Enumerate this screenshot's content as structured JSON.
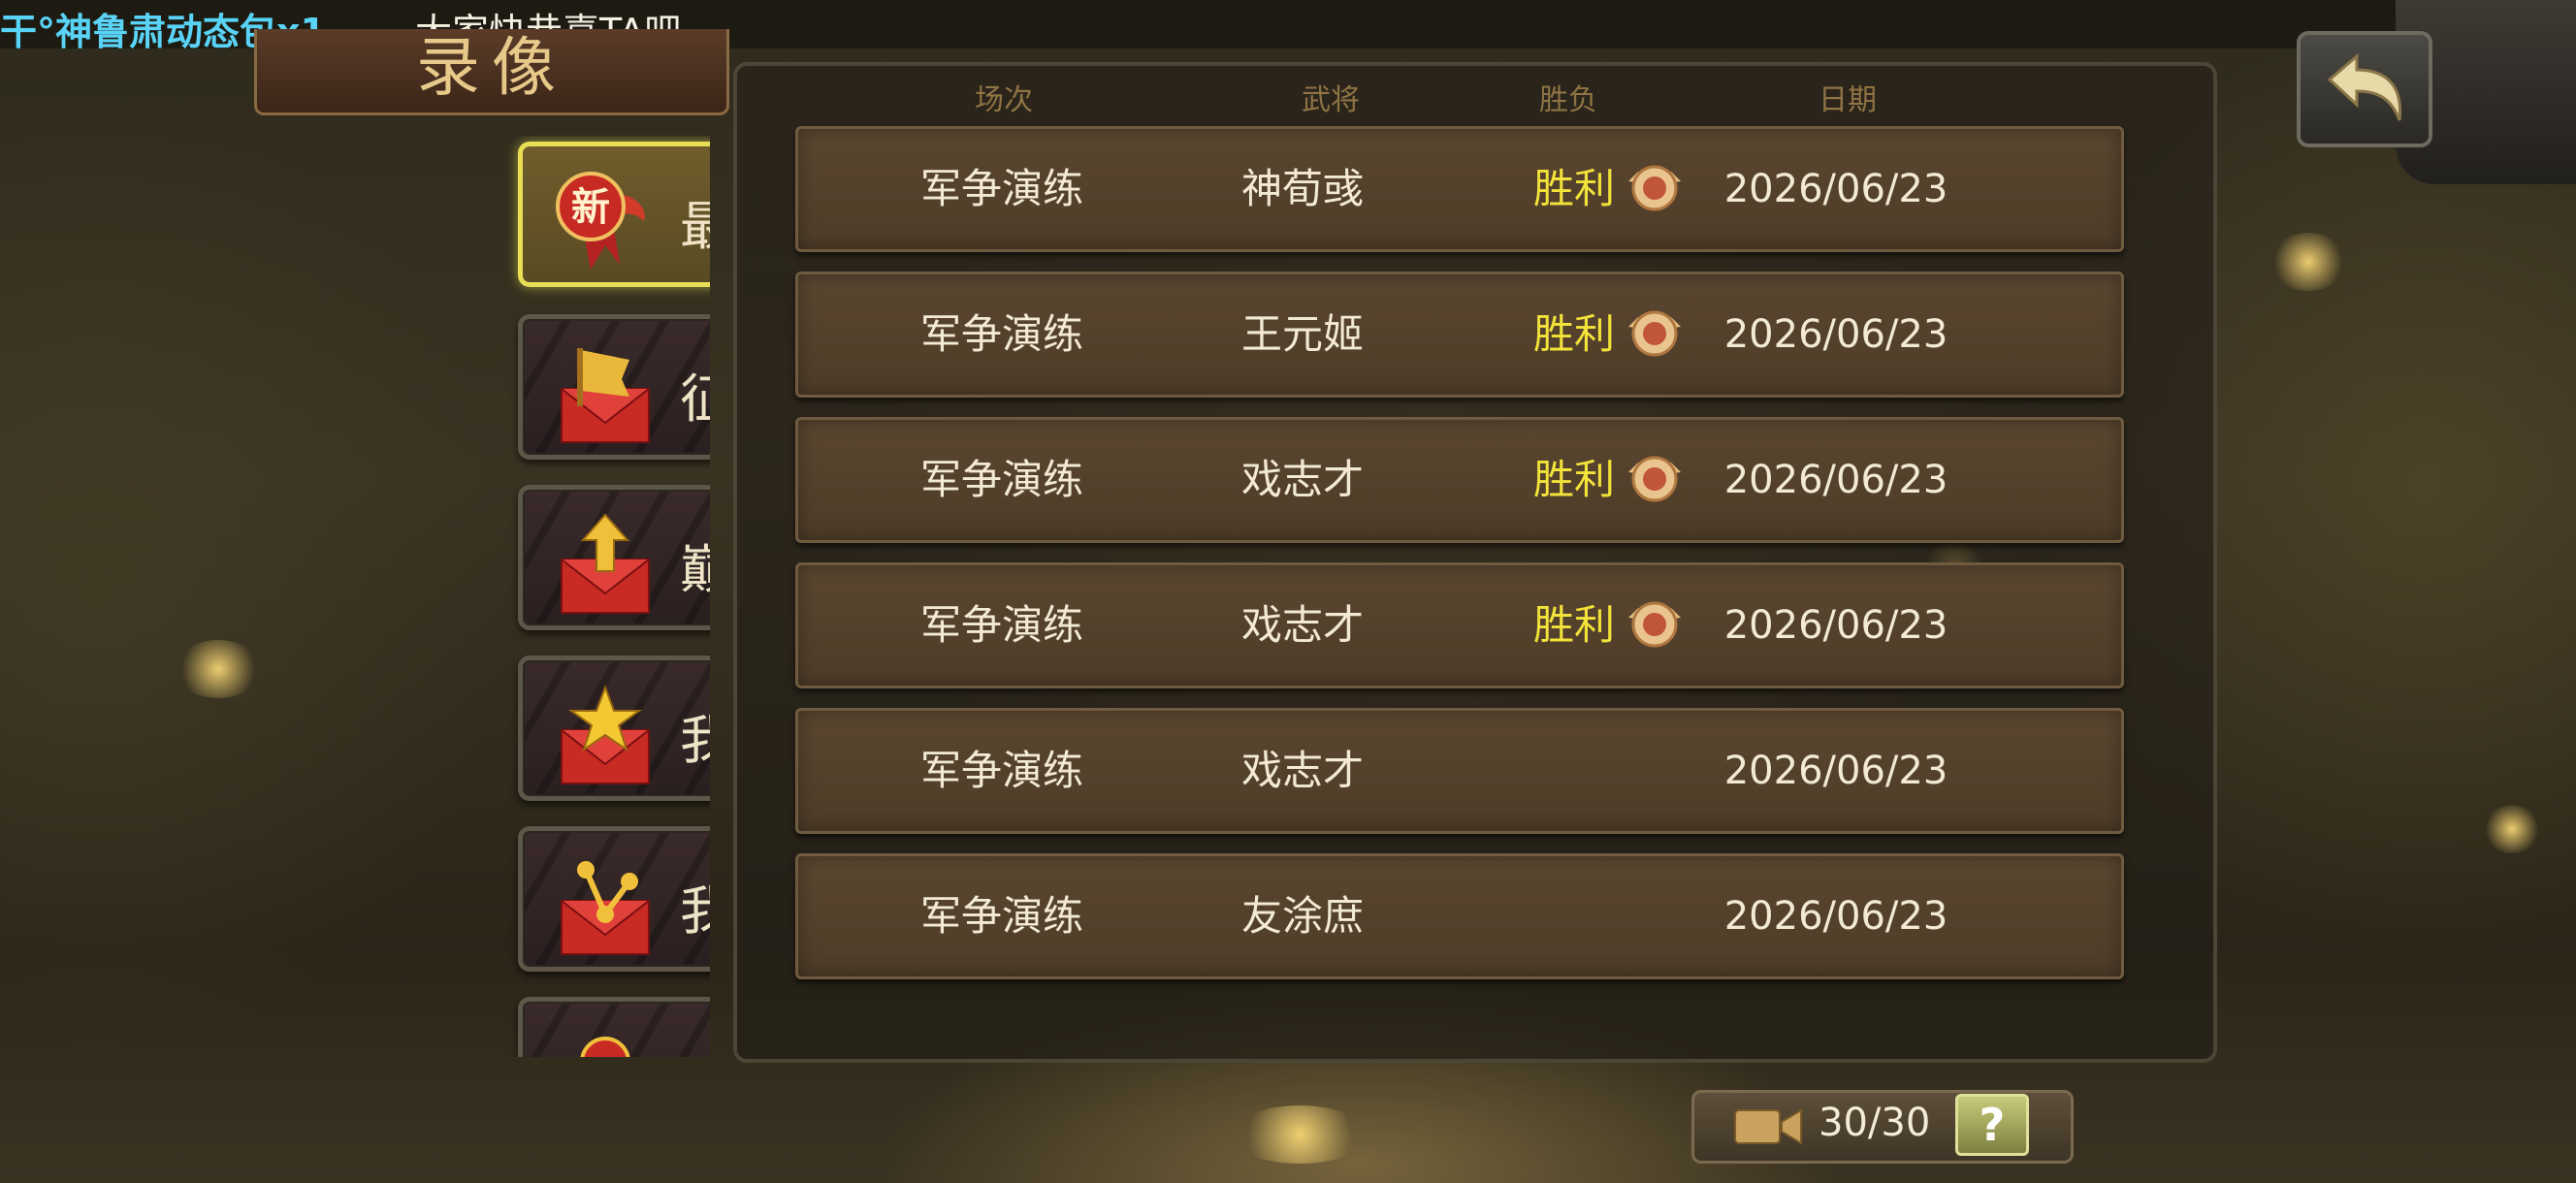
{
  "marquee": {
    "highlight": "干°神鲁肃动态包x1",
    "text": "，大家快恭喜TA吧"
  },
  "page_title": "录像",
  "sidebar": {
    "items": [
      {
        "label": "最新录像",
        "icon": "new-ribbon-icon",
        "active": true,
        "badge": "新"
      },
      {
        "label": "征战记录",
        "icon": "flag-envelope-icon",
        "active": false
      },
      {
        "label": "巅峰时刻",
        "icon": "arrow-envelope-icon",
        "active": false
      },
      {
        "label": "我的收藏",
        "icon": "star-envelope-icon",
        "active": false
      },
      {
        "label": "我的分享",
        "icon": "share-envelope-icon",
        "active": false
      }
    ]
  },
  "table": {
    "headers": [
      "场次",
      "武将",
      "胜负",
      "日期"
    ],
    "rows": [
      {
        "scene": "军争演练",
        "general": "神荀彧",
        "result": "胜利",
        "medal": true,
        "date": "2026/06/23"
      },
      {
        "scene": "军争演练",
        "general": "王元姬",
        "result": "胜利",
        "medal": true,
        "date": "2026/06/23"
      },
      {
        "scene": "军争演练",
        "general": "戏志才",
        "result": "胜利",
        "medal": true,
        "date": "2026/06/23"
      },
      {
        "scene": "军争演练",
        "general": "戏志才",
        "result": "胜利",
        "medal": true,
        "date": "2026/06/23"
      },
      {
        "scene": "军争演练",
        "general": "戏志才",
        "result": "",
        "medal": false,
        "date": "2026/06/23"
      },
      {
        "scene": "军争演练",
        "general": "友涂庶",
        "result": "",
        "medal": false,
        "date": "2026/06/23"
      }
    ]
  },
  "footer": {
    "count": "30/30",
    "help_label": "?"
  },
  "colors": {
    "active_border": "#e8df56",
    "win_text": "#f2e23a",
    "marquee_highlight": "#59d3f6",
    "header_text": "#8f7444"
  }
}
